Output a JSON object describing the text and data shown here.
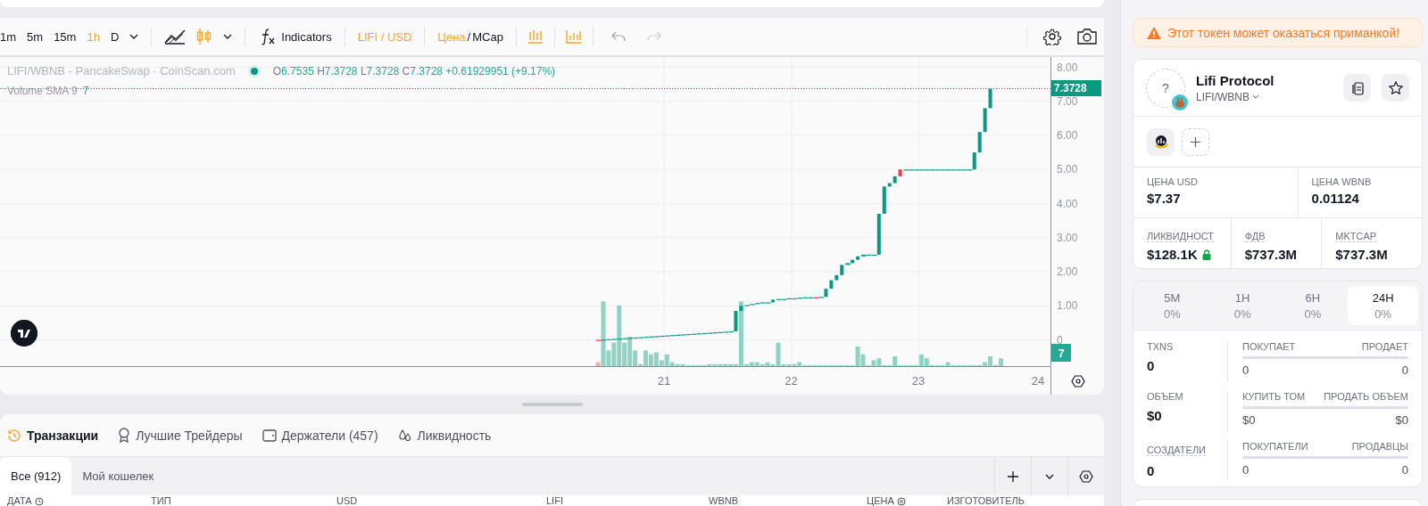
{
  "toolbar": {
    "intervals": [
      {
        "label": "1m",
        "selected": false
      },
      {
        "label": "5m",
        "selected": false
      },
      {
        "label": "15m",
        "selected": false
      },
      {
        "label": "1h",
        "selected": true
      },
      {
        "label": "D",
        "selected": false
      }
    ],
    "indicators_button": "Indicators",
    "pair_toggle": "LIFI / USD",
    "price_mode": [
      {
        "label": "Цена",
        "selected": true
      },
      {
        "label": "MCap",
        "selected": false
      }
    ],
    "separator": "/"
  },
  "chart": {
    "legend": {
      "title": "LIFI/WBNB - PancakeSwap · CoinScan.com",
      "ohlc": [
        {
          "key": "O",
          "value": "6.7535"
        },
        {
          "key": "H",
          "value": "7.3728"
        },
        {
          "key": "L",
          "value": "7.3728"
        },
        {
          "key": "C",
          "value": "7.3728"
        }
      ],
      "change": "+0.61929951 (+9.17%)"
    },
    "volume_legend": {
      "label": "Volume SMA 9",
      "value": "7"
    },
    "price_axis": [
      "8.00",
      "7.00",
      "6.00",
      "5.00",
      "4.00",
      "3.00",
      "2.00",
      "1.00",
      "0"
    ],
    "last_price": "7.3728",
    "volume_badge": "7",
    "time_axis": [
      "21",
      "22",
      "23",
      "24"
    ]
  },
  "bottom_tabs": [
    {
      "label": "Транзакции",
      "selected": true
    },
    {
      "label": "Лучшие Трейдеры",
      "selected": false
    },
    {
      "label": "Держатели (457)",
      "selected": false
    },
    {
      "label": "Ликвидность",
      "selected": false
    }
  ],
  "sub_tabs": [
    {
      "label": "Все (912)",
      "selected": true
    },
    {
      "label": "Мой кошелек",
      "selected": false
    }
  ],
  "table": {
    "columns": [
      "ДАТА",
      "ТИП",
      "USD",
      "LIFI",
      "WBNB",
      "ЦЕНА",
      "ИЗГОТОВИТЕЛЬ"
    ]
  },
  "warning": "Этот токен может оказаться приманкой!",
  "token": {
    "name": "Lifi Protocol",
    "pair": "LIFI/WBNB",
    "logo_placeholder": "?",
    "stats_row_1": [
      {
        "label": "ЦЕНА USD",
        "value": "$7.37",
        "locked": false
      },
      {
        "label": "ЦЕНА WBNB",
        "value": "0.01124",
        "locked": false
      }
    ],
    "stats_row_2": [
      {
        "label": "ЛИКВИДНОСТ",
        "value": "$128.1K",
        "locked": true
      },
      {
        "label": "ФДВ",
        "value": "$737.3M",
        "locked": false
      },
      {
        "label": "MKTCAP",
        "value": "$737.3M",
        "locked": false
      }
    ]
  },
  "periods": [
    {
      "label": "5M",
      "change": "0%",
      "selected": false
    },
    {
      "label": "1H",
      "change": "0%",
      "selected": false
    },
    {
      "label": "6H",
      "change": "0%",
      "selected": false
    },
    {
      "label": "24H",
      "change": "0%",
      "selected": true
    }
  ],
  "activity": [
    {
      "label": "TXNS",
      "value": "0",
      "left_label": "ПОКУПАЕТ",
      "right_label": "ПРОДАЕТ",
      "left_value": "0",
      "right_value": "0"
    },
    {
      "label": "ОБЪЕМ",
      "value": "$0",
      "left_label": "КУПИТЬ ТОМ",
      "right_label": "ПРОДАТЬ ОБЪЕМ",
      "left_value": "$0",
      "right_value": "$0"
    },
    {
      "label": "СОЗДАТЕЛИ",
      "value": "0",
      "left_label": "ПОКУПАТЕЛИ",
      "right_label": "ПРОДАВЦЫ",
      "left_value": "0",
      "right_value": "0"
    }
  ]
}
